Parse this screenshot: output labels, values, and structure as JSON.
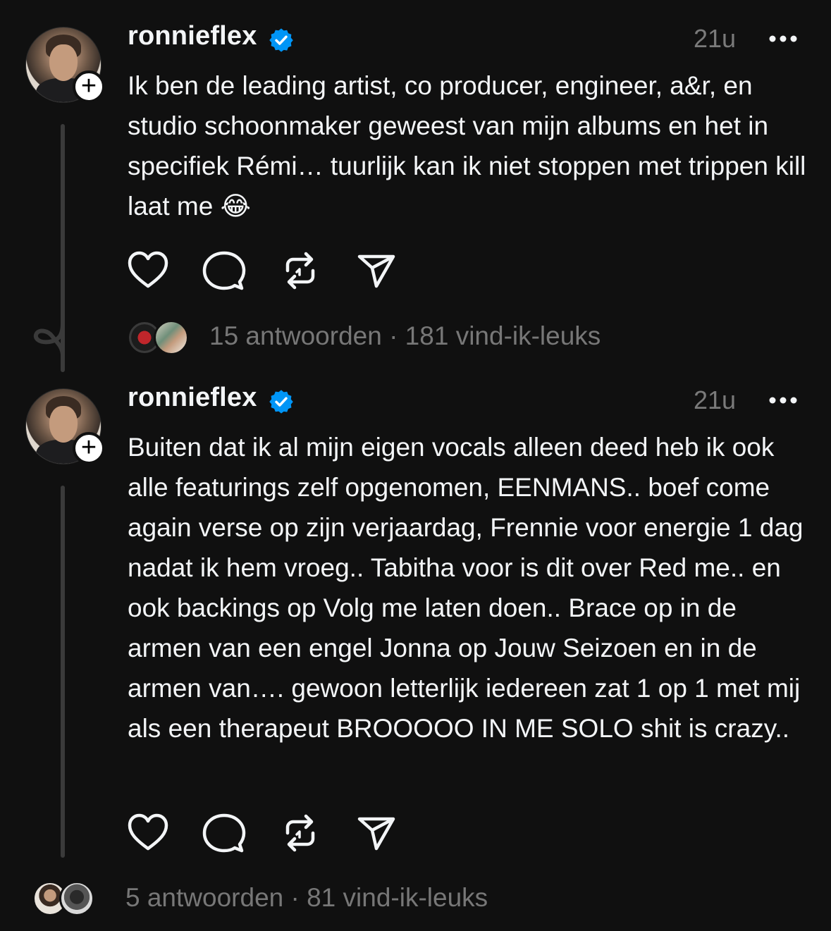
{
  "posts": [
    {
      "username": "ronnieflex",
      "time": "21u",
      "text": "Ik ben de leading artist, co producer, engineer, a&r, en studio schoonmaker geweest van mijn albums en het in specifiek Rémi… tuurlijk kan ik niet stoppen met trippen kill laat me 😂",
      "stats": "15 antwoorden · 181 vind-ik-leuks"
    },
    {
      "username": "ronnieflex",
      "time": "21u",
      "text": "Buiten dat ik al mijn eigen vocals alleen deed heb ik ook alle featurings zelf opgenomen, EENMANS.. boef come again verse op zijn verjaardag, Frennie voor energie 1 dag nadat ik hem vroeg.. Tabitha voor is dit over Red me.. en ook backings op Volg me laten doen.. Brace op in de armen van een engel Jonna op Jouw Seizoen en in de armen van…. gewoon letterlijk iedereen zat 1 op 1 met mij als een therapeut BROOOOO IN ME SOLO shit is crazy..",
      "stats": "5 antwoorden · 81 vind-ik-leuks"
    }
  ],
  "follow_symbol": "+",
  "colors": {
    "background": "#101010",
    "text": "#f3f5f7",
    "muted": "#777777",
    "verified": "#0095f6"
  },
  "icons": [
    "heart-icon",
    "comment-icon",
    "repost-icon",
    "share-icon",
    "more-icon",
    "verified-icon",
    "thread-loop-icon"
  ]
}
